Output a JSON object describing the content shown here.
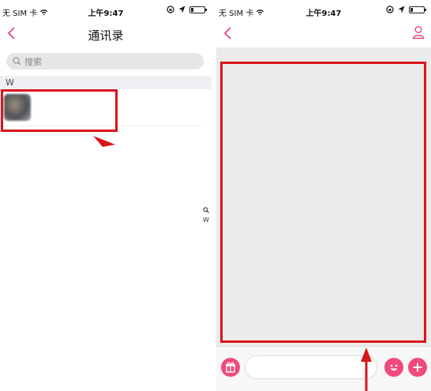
{
  "status_bar": {
    "carrier": "无 SIM 卡",
    "time": "上午9:47"
  },
  "contacts_screen": {
    "title": "通讯录",
    "search_placeholder": "搜索",
    "section_letter": "W",
    "index_letter": "W",
    "contact_name": ""
  },
  "chat_screen": {
    "title": "",
    "message_input_value": ""
  },
  "colors": {
    "accent_pink": "#f04a7a",
    "annotation_red": "#d9141b",
    "chat_background": "#ebebeb"
  },
  "icons": [
    "back-icon",
    "search-icon",
    "wifi-icon",
    "location-arrow-icon",
    "rotation-lock-icon",
    "battery-icon",
    "profile-icon",
    "gift-icon",
    "emoji-icon",
    "plus-icon"
  ]
}
